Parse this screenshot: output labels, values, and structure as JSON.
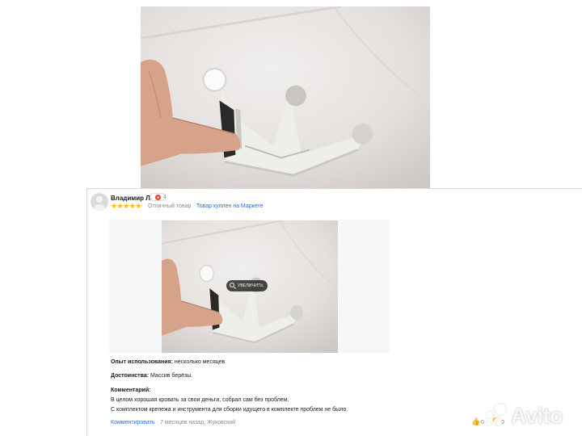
{
  "review": {
    "author": "Владимир Л.",
    "badge_count": "4",
    "stars": "★★★★★",
    "rating_text": "Отличный товар",
    "purchase_link": "Товар куплен на Маркете",
    "zoom_label": "Увеличить",
    "experience_label": "Опыт использования:",
    "experience_value": "несколько месяцев",
    "advantages_label": "Достоинства:",
    "advantages_value": "Массив берёзы.",
    "comment_label": "Комментарий:",
    "comment_line_1": "В целом хорошая кровать за свои деньги, собрал сам без проблем.",
    "comment_line_2": "С комплектом крепежа и инструмента для сборки идущего в комплекте проблем не было.",
    "comment_link": "Комментировать",
    "meta": "7 месяцев назад, Жуковский",
    "likes": "0",
    "dislikes": "0"
  },
  "watermark": {
    "text": "Avito"
  },
  "colors": {
    "star": "#ffb800",
    "link": "#2c6dd8",
    "badge": "#f4364c"
  }
}
